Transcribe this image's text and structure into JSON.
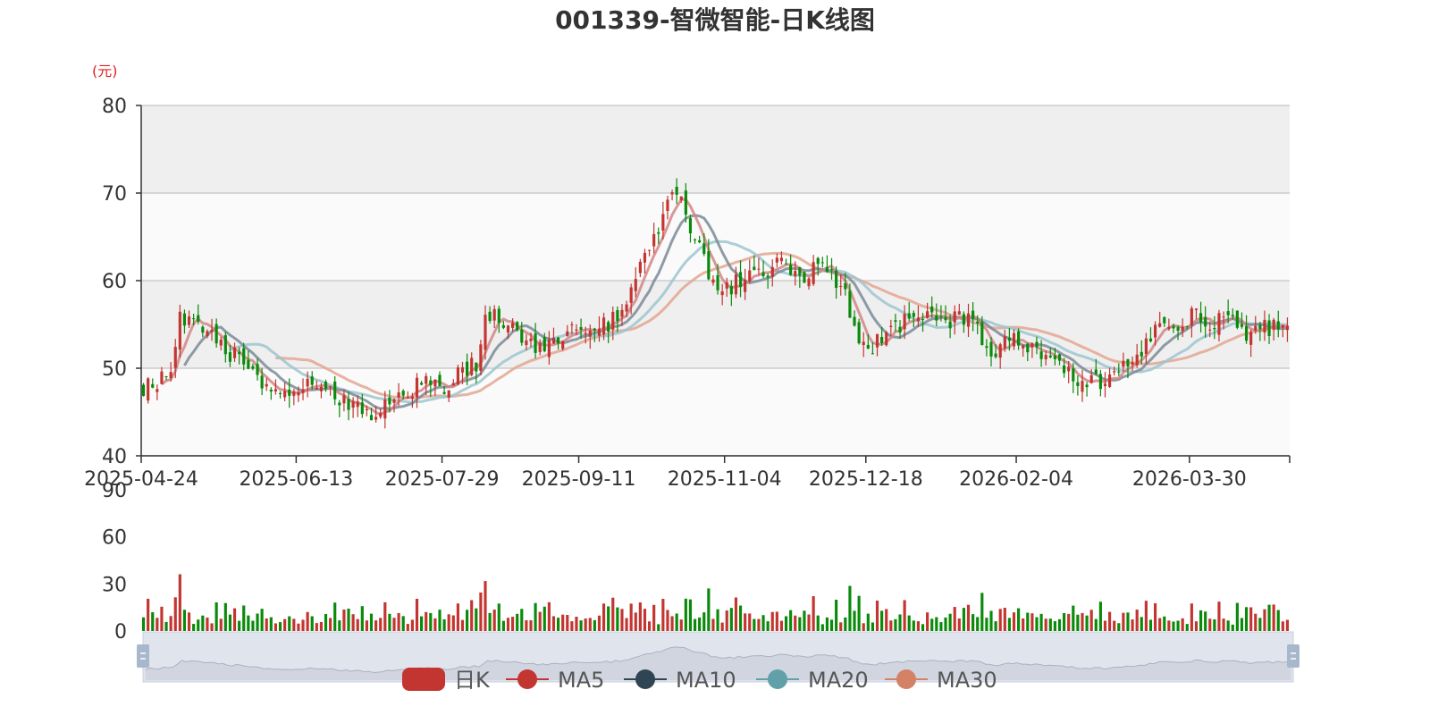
{
  "chart_data": {
    "type": "candlestick",
    "title": "001339-智微智能-日K线图",
    "unit_label": "(元)",
    "price_axis": {
      "ylim": [
        40,
        80
      ],
      "ticks": [
        40,
        50,
        60,
        70,
        80
      ],
      "grid": true
    },
    "volume_axis": {
      "ylim": [
        0,
        90
      ],
      "ticks": [
        0,
        30,
        60,
        90
      ]
    },
    "x_tick_labels": [
      "2025-04-24",
      "2025-06-13",
      "2025-07-29",
      "2025-09-11",
      "2025-11-04",
      "2025-12-18",
      "2026-02-04",
      "2026-03-30"
    ],
    "x_tick_index": [
      0,
      34,
      66,
      96,
      128,
      159,
      192,
      230
    ],
    "num_days": 252,
    "colors": {
      "up": "#c23531",
      "down": "#0a8a0a",
      "ma5": "#d48586",
      "ma10": "#7b8a97",
      "ma20": "#9cc6cf",
      "ma30": "#e3a692",
      "band_dark": "#efefef",
      "band_light": "#fafafa",
      "grid": "#cccccc",
      "zoom_fill": "#dfe4ed",
      "zoom_handle": "#a7b7cc"
    },
    "legend": [
      {
        "name": "日K",
        "color": "#c23531",
        "shape": "candle"
      },
      {
        "name": "MA5",
        "color": "#c23531",
        "shape": "circle-line"
      },
      {
        "name": "MA10",
        "color": "#2f4554",
        "shape": "circle-line"
      },
      {
        "name": "MA20",
        "color": "#61a0a8",
        "shape": "circle-line"
      },
      {
        "name": "MA30",
        "color": "#d48265",
        "shape": "circle-line"
      }
    ],
    "close_anchors": [
      [
        0,
        47.8
      ],
      [
        3,
        48.0
      ],
      [
        6,
        50.5
      ],
      [
        8,
        56.0
      ],
      [
        11,
        55.3
      ],
      [
        16,
        53.0
      ],
      [
        22,
        50.5
      ],
      [
        28,
        47.8
      ],
      [
        32,
        46.0
      ],
      [
        36,
        48.5
      ],
      [
        42,
        47.0
      ],
      [
        48,
        45.0
      ],
      [
        50,
        44.8
      ],
      [
        53,
        46.5
      ],
      [
        60,
        48.0
      ],
      [
        66,
        48.0
      ],
      [
        70,
        49.5
      ],
      [
        73,
        50.5
      ],
      [
        75,
        56.5
      ],
      [
        80,
        55.5
      ],
      [
        84,
        52.5
      ],
      [
        90,
        53.0
      ],
      [
        96,
        55.0
      ],
      [
        100,
        54.5
      ],
      [
        104,
        56.0
      ],
      [
        108,
        60.0
      ],
      [
        112,
        65.0
      ],
      [
        116,
        70.0
      ],
      [
        118,
        69.0
      ],
      [
        121,
        64.5
      ],
      [
        125,
        60.0
      ],
      [
        128,
        59.0
      ],
      [
        132,
        60.5
      ],
      [
        137,
        61.0
      ],
      [
        140,
        63.0
      ],
      [
        144,
        60.0
      ],
      [
        148,
        62.0
      ],
      [
        151,
        61.0
      ],
      [
        154,
        58.0
      ],
      [
        157,
        53.0
      ],
      [
        160,
        52.5
      ],
      [
        164,
        54.0
      ],
      [
        168,
        56.0
      ],
      [
        172,
        56.5
      ],
      [
        176,
        55.5
      ],
      [
        180,
        55.5
      ],
      [
        183,
        54.5
      ],
      [
        185,
        51.5
      ],
      [
        188,
        52.5
      ],
      [
        192,
        53.5
      ],
      [
        196,
        51.5
      ],
      [
        199,
        50.5
      ],
      [
        203,
        49.5
      ],
      [
        206,
        48.0
      ],
      [
        210,
        48.5
      ],
      [
        214,
        49.5
      ],
      [
        218,
        51.5
      ],
      [
        222,
        55.0
      ],
      [
        226,
        54.0
      ],
      [
        230,
        56.0
      ],
      [
        234,
        55.5
      ],
      [
        238,
        55.5
      ],
      [
        242,
        54.0
      ],
      [
        246,
        54.5
      ],
      [
        251,
        55.0
      ]
    ],
    "notes": "Daily OHLC candlesticks with MA5/MA10/MA20/MA30 overlays and a volume sub-panel; closes interpolated between the listed [day_index, price] anchors."
  }
}
